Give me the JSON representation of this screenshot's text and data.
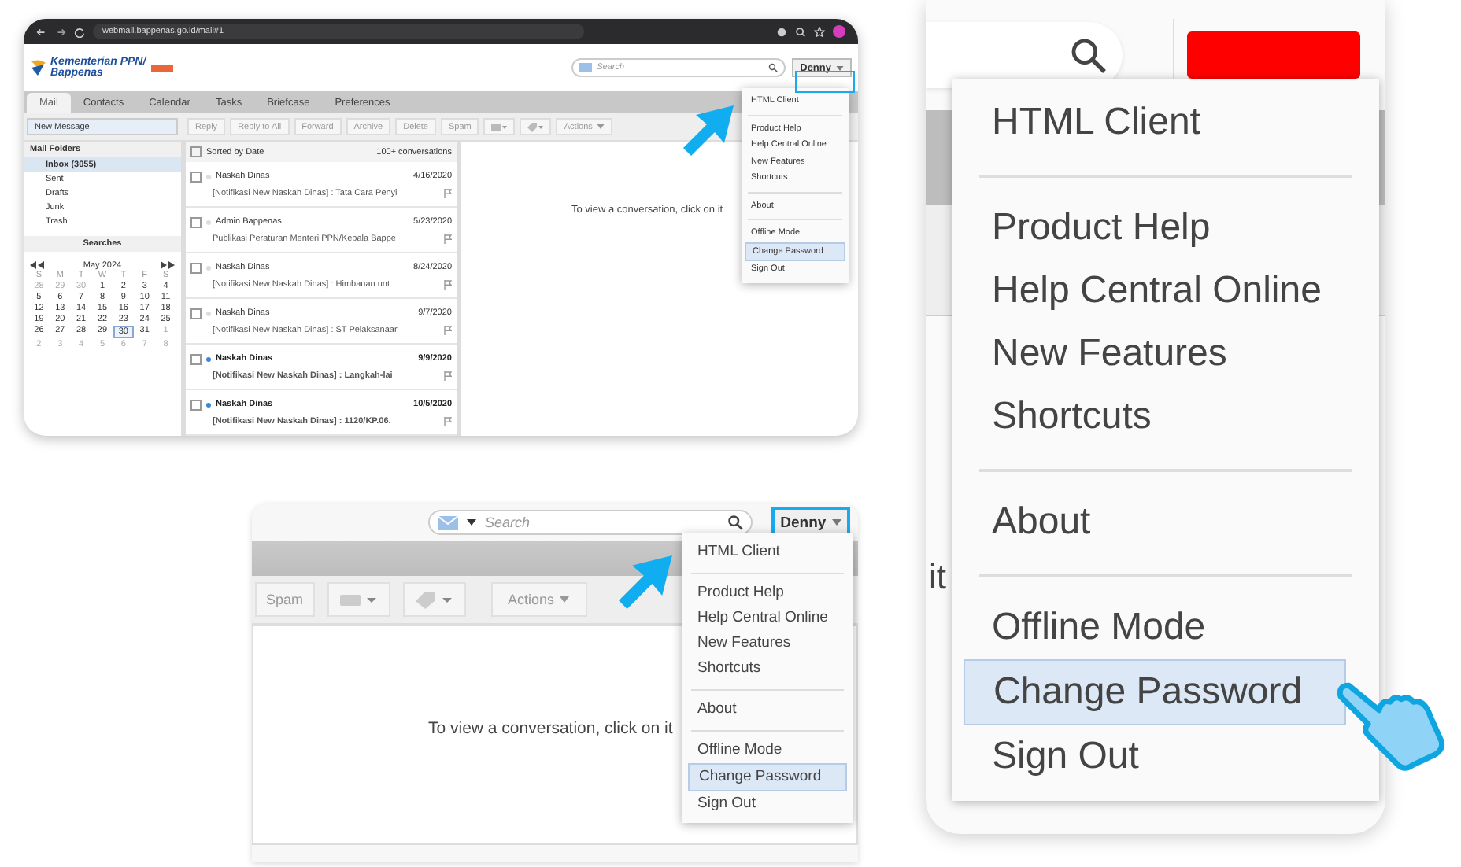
{
  "browser": {
    "url": "webmail.bappenas.go.id/mail#1"
  },
  "full": {
    "logo": [
      "Kementerian PPN/",
      "Bappenas"
    ],
    "tabs": [
      {
        "label": "Mail",
        "selected": true
      },
      {
        "label": "Contacts",
        "selected": false
      },
      {
        "label": "Calendar",
        "selected": false
      },
      {
        "label": "Tasks",
        "selected": false
      },
      {
        "label": "Briefcase",
        "selected": false
      },
      {
        "label": "Preferences",
        "selected": false
      }
    ],
    "search": {
      "placeholder": "Search"
    },
    "user_button": "Denny",
    "new_message": "New Message",
    "toolbar": [
      "Reply",
      "Reply to All",
      "Forward",
      "Archive",
      "Delete",
      "Spam"
    ],
    "actions": "Actions",
    "folders_title": "Mail Folders",
    "folders": [
      {
        "label": "Inbox (3055)",
        "selected": true
      },
      {
        "label": "Sent",
        "selected": false
      },
      {
        "label": "Drafts",
        "selected": false
      },
      {
        "label": "Junk",
        "selected": false
      },
      {
        "label": "Trash",
        "selected": false
      }
    ],
    "searches_title": "Searches",
    "calendar": {
      "month": "May 2024",
      "weekdays": [
        "S",
        "M",
        "T",
        "W",
        "T",
        "F",
        "S"
      ],
      "days": [
        {
          "label": "28",
          "outside": true,
          "today": false
        },
        {
          "label": "29",
          "outside": true,
          "today": false
        },
        {
          "label": "30",
          "outside": true,
          "today": false
        },
        {
          "label": "1",
          "outside": false,
          "today": false
        },
        {
          "label": "2",
          "outside": false,
          "today": false
        },
        {
          "label": "3",
          "outside": false,
          "today": false
        },
        {
          "label": "4",
          "outside": false,
          "today": false
        },
        {
          "label": "5",
          "outside": false,
          "today": false
        },
        {
          "label": "6",
          "outside": false,
          "today": false
        },
        {
          "label": "7",
          "outside": false,
          "today": false
        },
        {
          "label": "8",
          "outside": false,
          "today": false
        },
        {
          "label": "9",
          "outside": false,
          "today": false
        },
        {
          "label": "10",
          "outside": false,
          "today": false
        },
        {
          "label": "11",
          "outside": false,
          "today": false
        },
        {
          "label": "12",
          "outside": false,
          "today": false
        },
        {
          "label": "13",
          "outside": false,
          "today": false
        },
        {
          "label": "14",
          "outside": false,
          "today": false
        },
        {
          "label": "15",
          "outside": false,
          "today": false
        },
        {
          "label": "16",
          "outside": false,
          "today": false
        },
        {
          "label": "17",
          "outside": false,
          "today": false
        },
        {
          "label": "18",
          "outside": false,
          "today": false
        },
        {
          "label": "19",
          "outside": false,
          "today": false
        },
        {
          "label": "20",
          "outside": false,
          "today": false
        },
        {
          "label": "21",
          "outside": false,
          "today": false
        },
        {
          "label": "22",
          "outside": false,
          "today": false
        },
        {
          "label": "23",
          "outside": false,
          "today": false
        },
        {
          "label": "24",
          "outside": false,
          "today": false
        },
        {
          "label": "25",
          "outside": false,
          "today": false
        },
        {
          "label": "26",
          "outside": false,
          "today": false
        },
        {
          "label": "27",
          "outside": false,
          "today": false
        },
        {
          "label": "28",
          "outside": false,
          "today": false
        },
        {
          "label": "29",
          "outside": false,
          "today": false
        },
        {
          "label": "30",
          "outside": false,
          "today": true
        },
        {
          "label": "31",
          "outside": false,
          "today": false
        },
        {
          "label": "1",
          "outside": true,
          "today": false
        },
        {
          "label": "2",
          "outside": true,
          "today": false
        },
        {
          "label": "3",
          "outside": true,
          "today": false
        },
        {
          "label": "4",
          "outside": true,
          "today": false
        },
        {
          "label": "5",
          "outside": true,
          "today": false
        },
        {
          "label": "6",
          "outside": true,
          "today": false
        },
        {
          "label": "7",
          "outside": true,
          "today": false
        },
        {
          "label": "8",
          "outside": true,
          "today": false
        }
      ]
    },
    "list": {
      "sort": "Sorted by Date",
      "count": "100+ conversations",
      "all_checked": false,
      "rows": [
        {
          "sender": "Naskah Dinas",
          "date": "4/16/2020",
          "subject": "[Notifikasi New Naskah Dinas] : Tata Cara Penyi",
          "unread": false,
          "checked": false
        },
        {
          "sender": "Admin Bappenas",
          "date": "5/23/2020",
          "subject": "Publikasi Peraturan Menteri PPN/Kepala Bappe",
          "unread": false,
          "checked": false
        },
        {
          "sender": "Naskah Dinas",
          "date": "8/24/2020",
          "subject": "[Notifikasi New Naskah Dinas] : Himbauan unt",
          "unread": false,
          "checked": false
        },
        {
          "sender": "Naskah Dinas",
          "date": "9/7/2020",
          "subject": "[Notifikasi New Naskah Dinas] : ST Pelaksanaar",
          "unread": false,
          "checked": false
        },
        {
          "sender": "Naskah Dinas",
          "date": "9/9/2020",
          "subject": "[Notifikasi New Naskah Dinas] : Langkah-lai",
          "unread": true,
          "checked": false
        },
        {
          "sender": "Naskah Dinas",
          "date": "10/5/2020",
          "subject": "[Notifikasi New Naskah Dinas] : 1120/KP.06.",
          "unread": true,
          "checked": false
        }
      ]
    },
    "reading_pane": "To view a conversation, click on it",
    "menu": [
      [
        {
          "label": "HTML Client",
          "selected": false
        }
      ],
      [
        {
          "label": "Product Help",
          "selected": false
        },
        {
          "label": "Help Central Online",
          "selected": false
        },
        {
          "label": "New Features",
          "selected": false
        },
        {
          "label": "Shortcuts",
          "selected": false
        }
      ],
      [
        {
          "label": "About",
          "selected": false
        }
      ],
      [
        {
          "label": "Offline Mode",
          "selected": false
        },
        {
          "label": "Change Password",
          "selected": true
        },
        {
          "label": "Sign Out",
          "selected": false
        }
      ]
    ]
  },
  "zoom": {
    "search": {
      "placeholder": "Search"
    },
    "user_button": "Denny",
    "toolbar": [
      "Spam"
    ],
    "actions": "Actions",
    "reading_pane": "To view a conversation, click on it",
    "menu": [
      [
        {
          "label": "HTML Client",
          "selected": false
        }
      ],
      [
        {
          "label": "Product Help",
          "selected": false
        },
        {
          "label": "Help Central Online",
          "selected": false
        },
        {
          "label": "New Features",
          "selected": false
        },
        {
          "label": "Shortcuts",
          "selected": false
        }
      ],
      [
        {
          "label": "About",
          "selected": false
        }
      ],
      [
        {
          "label": "Offline Mode",
          "selected": false
        },
        {
          "label": "Change Password",
          "selected": true
        },
        {
          "label": "Sign Out",
          "selected": false
        }
      ]
    ]
  },
  "closeup": {
    "reading_fragment": "it",
    "menu": [
      [
        {
          "label": "HTML Client",
          "selected": false
        }
      ],
      [
        {
          "label": "Product Help",
          "selected": false
        },
        {
          "label": "Help Central Online",
          "selected": false
        },
        {
          "label": "New Features",
          "selected": false
        },
        {
          "label": "Shortcuts",
          "selected": false
        }
      ],
      [
        {
          "label": "About",
          "selected": false
        }
      ],
      [
        {
          "label": "Offline Mode",
          "selected": false
        },
        {
          "label": "Change Password",
          "selected": true
        },
        {
          "label": "Sign Out",
          "selected": false
        }
      ]
    ]
  }
}
